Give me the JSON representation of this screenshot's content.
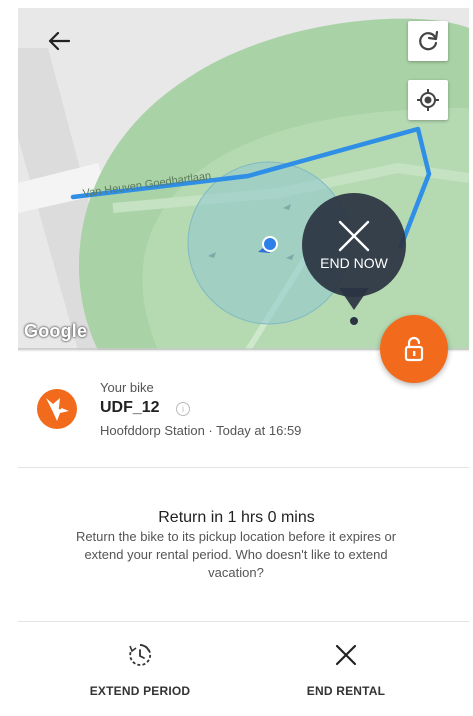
{
  "map": {
    "street_label": "Van Heuven Goedhartlaan",
    "attribution": "Google",
    "end_now_label": "END NOW",
    "icons": {
      "back": "arrow-left-icon",
      "refresh": "refresh-icon",
      "locate": "my-location-icon",
      "end_now": "close-icon",
      "unlock": "unlock-icon"
    },
    "colors": {
      "route": "#2f8ee6",
      "park": "#a9d2a6",
      "accent": "#f26a1b",
      "end_now_bg": "#2b3442"
    }
  },
  "bike": {
    "caption": "Your bike",
    "id": "UDF_12",
    "location": "Hoofddorp Station · Today at 16:59",
    "icon": "bike-provider-logo"
  },
  "return": {
    "title": "Return in 1 hrs 0 mins",
    "description": "Return the bike to its pickup location before it expires or extend your rental period. Who doesn't like to extend vacation?"
  },
  "actions": {
    "extend": {
      "label": "EXTEND PERIOD",
      "icon": "timer-extend-icon"
    },
    "end": {
      "label": "END RENTAL",
      "icon": "close-icon"
    }
  }
}
